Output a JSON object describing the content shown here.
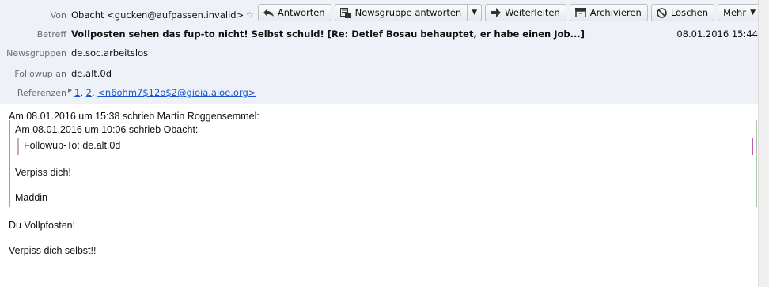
{
  "header": {
    "from_label": "Von",
    "from_value": "Obacht <gucken@aufpassen.invalid>",
    "subject_label": "Betreff",
    "subject_value": "Vollposten sehen das fup-to nicht! Selbst schuld! [Re: Detlef Bosau behauptet, er habe einen Job...]",
    "date": "08.01.2016 15:44",
    "newsgroups_label": "Newsgruppen",
    "newsgroups_value": "de.soc.arbeitslos",
    "followup_label": "Followup an",
    "followup_value": "de.alt.0d",
    "references_label": "Referenzen",
    "references": [
      "1",
      "2",
      "<n6ohm7$12o$2@gioia.aioe.org>"
    ],
    "ref_sep": ","
  },
  "toolbar": {
    "reply": "Antworten",
    "reply_newsgroup": "Newsgruppe antworten",
    "forward": "Weiterleiten",
    "archive": "Archivieren",
    "delete": "Löschen",
    "more": "Mehr"
  },
  "message": {
    "attribution_outer": "Am 08.01.2016 um 15:38 schrieb Martin Roggensemmel:",
    "attribution_inner": "Am 08.01.2016 um 10:06 schrieb Obacht:",
    "inner_quote": "Followup-To: de.alt.0d",
    "quote_line1": "Verpiss dich!",
    "quote_line2": "Maddin",
    "reply_line1": "Du Vollpfosten!",
    "reply_line2": "Verpiss dich selbst!!"
  }
}
